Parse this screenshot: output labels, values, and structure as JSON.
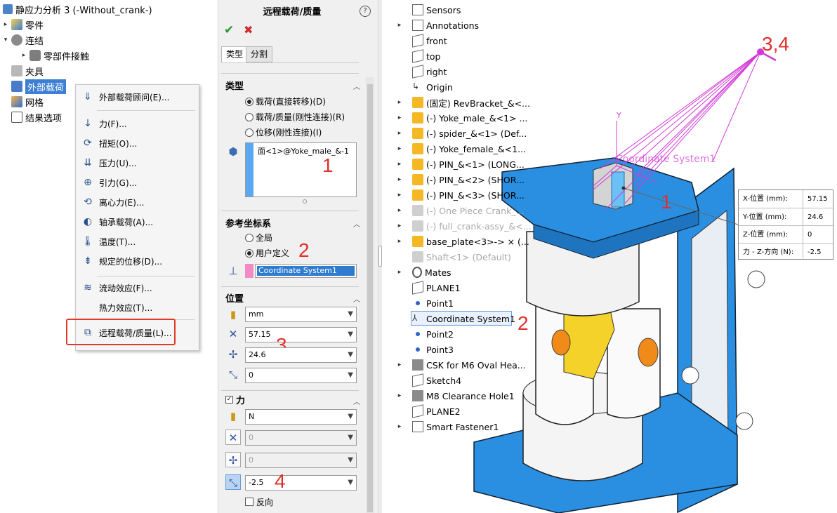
{
  "sim_tree": {
    "title": "静应力分析 3 (-Without_crank-)",
    "items": [
      {
        "label": "零件",
        "icon": "parts-icon",
        "expander": "▸"
      },
      {
        "label": "连结",
        "icon": "connections-icon",
        "expander": "▾"
      },
      {
        "label": "零部件接触",
        "icon": "contact-icon",
        "expander": "▸"
      },
      {
        "label": "夹具",
        "icon": "fixture-icon",
        "expander": ""
      },
      {
        "label": "外部载荷",
        "icon": "external-load-icon",
        "expander": ""
      },
      {
        "label": "网格",
        "icon": "mesh-icon",
        "expander": ""
      },
      {
        "label": "结果选项",
        "icon": "result-options-icon",
        "expander": ""
      }
    ]
  },
  "context_menu": {
    "items": [
      {
        "label": "外部载荷顾问(E)...",
        "icon": "load-advisor-icon",
        "glyph": "⇓"
      },
      {
        "label": "力(F)...",
        "icon": "force-icon",
        "glyph": "↓"
      },
      {
        "label": "扭矩(O)...",
        "icon": "torque-icon",
        "glyph": "⟳"
      },
      {
        "label": "压力(U)...",
        "icon": "pressure-icon",
        "glyph": "⇊"
      },
      {
        "label": "引力(G)...",
        "icon": "gravity-icon",
        "glyph": "⊕"
      },
      {
        "label": "离心力(E)...",
        "icon": "centrifugal-icon",
        "glyph": "⟲"
      },
      {
        "label": "轴承载荷(A)...",
        "icon": "bearing-load-icon",
        "glyph": "◐"
      },
      {
        "label": "温度(T)...",
        "icon": "temperature-icon",
        "glyph": "🌡"
      },
      {
        "label": "规定的位移(D)...",
        "icon": "displacement-icon",
        "glyph": "⇟"
      },
      {
        "label": "流动效应(F)...",
        "icon": "flow-effect-icon",
        "glyph": "≋"
      },
      {
        "label": "热力效应(T)...",
        "icon": "thermal-effect-icon",
        "glyph": ""
      },
      {
        "label": "远程载荷/质量(L)...",
        "icon": "remote-load-icon",
        "glyph": "⧉"
      }
    ]
  },
  "property_manager": {
    "title": "远程载荷/质量",
    "help": "?",
    "ok": "✔",
    "cancel": "✖",
    "tabs": [
      "类型",
      "分割"
    ],
    "type_section": {
      "title": "类型",
      "options": [
        "载荷(直接转移)(D)",
        "载荷/质量(刚性连接)(R)",
        "位移(刚性连接)(I)"
      ],
      "selected": 0,
      "face_selection": "面<1>@Yoke_male_&-1"
    },
    "ref_coord": {
      "title": "参考坐标系",
      "options": [
        "全局",
        "用户定义"
      ],
      "selected": 1,
      "coord_system": "Coordinate System1"
    },
    "location": {
      "title": "位置",
      "unit": "mm",
      "x": "57.15",
      "y": "24.6",
      "z": "0"
    },
    "force": {
      "title": "力",
      "unit": "N",
      "fx": "0",
      "fy": "0",
      "fz": "-2.5",
      "reverse_label": "反向"
    }
  },
  "annotations": {
    "n1": "1",
    "n2": "2",
    "n3": "3",
    "n4": "4",
    "viewport_1": "1",
    "tree_2": "2",
    "point_34": "3,4"
  },
  "feature_tree": {
    "items": [
      {
        "label": "Sensors",
        "icon": "sensors-icon",
        "expander": ""
      },
      {
        "label": "Annotations",
        "icon": "annotations-icon",
        "expander": "▸"
      },
      {
        "label": "front",
        "icon": "plane-icon",
        "expander": ""
      },
      {
        "label": "top",
        "icon": "plane-icon",
        "expander": ""
      },
      {
        "label": "right",
        "icon": "plane-icon",
        "expander": ""
      },
      {
        "label": "Origin",
        "icon": "origin-icon",
        "expander": ""
      },
      {
        "label": "(固定) RevBracket_&<...",
        "icon": "part-icon",
        "expander": "▸"
      },
      {
        "label": "(-) Yoke_male_&<1> ...",
        "icon": "part-icon",
        "expander": "▸"
      },
      {
        "label": "(-) spider_&<1> (Def...",
        "icon": "part-icon",
        "expander": "▸"
      },
      {
        "label": "(-) Yoke_female_&<1...",
        "icon": "part-icon",
        "expander": "▸"
      },
      {
        "label": "(-) PIN_&<1> (LONG...",
        "icon": "part-icon",
        "expander": "▸"
      },
      {
        "label": "(-) PIN_&<2> (SHOR...",
        "icon": "part-icon",
        "expander": "▸"
      },
      {
        "label": "(-) PIN_&<3> (SHOR...",
        "icon": "part-icon",
        "expander": "▸"
      },
      {
        "label": "(-) One Piece Crank_...",
        "icon": "suppressed-part-icon",
        "expander": "▸",
        "ghost": true
      },
      {
        "label": "(-) full_crank-assy_&<...",
        "icon": "suppressed-assembly-icon",
        "expander": "▸",
        "ghost": true
      },
      {
        "label": "base_plate<3>-> × (...",
        "icon": "part-icon",
        "expander": "▸"
      },
      {
        "label": "Shaft<1> (Default)",
        "icon": "suppressed-part-icon",
        "expander": "",
        "ghost": true
      },
      {
        "label": "Mates",
        "icon": "mates-icon",
        "expander": "▸"
      },
      {
        "label": "PLANE1",
        "icon": "plane-icon",
        "expander": ""
      },
      {
        "label": "Point1",
        "icon": "point-icon",
        "expander": ""
      },
      {
        "label": "Coordinate System1",
        "icon": "coordinate-system-icon",
        "expander": ""
      },
      {
        "label": "Point2",
        "icon": "point-icon",
        "expander": ""
      },
      {
        "label": "Point3",
        "icon": "point-icon",
        "expander": ""
      },
      {
        "label": "CSK for M6 Oval Hea...",
        "icon": "hole-feature-icon",
        "expander": "▸"
      },
      {
        "label": "Sketch4",
        "icon": "sketch-icon",
        "expander": ""
      },
      {
        "label": "M8 Clearance Hole1",
        "icon": "hole-feature-icon",
        "expander": "▸"
      },
      {
        "label": "PLANE2",
        "icon": "plane-icon",
        "expander": ""
      },
      {
        "label": "Smart Fastener1",
        "icon": "fastener-icon",
        "expander": "▸"
      }
    ]
  },
  "callout": {
    "rows": [
      {
        "label": "X-位置 (mm):",
        "value": "57.15"
      },
      {
        "label": "Y-位置 (mm):",
        "value": "24.6"
      },
      {
        "label": "Z-位置 (mm):",
        "value": "0"
      },
      {
        "label": "力 - Z-方向 (N):",
        "value": "-2.5"
      }
    ]
  },
  "viewport": {
    "coord_label": "Coordinate System1",
    "axis_y": "Y",
    "colors": {
      "plate": "#2a8fe0",
      "pin": "#f08a18",
      "spider": "#f5d22a",
      "load_lines": "#d13ad6"
    }
  }
}
